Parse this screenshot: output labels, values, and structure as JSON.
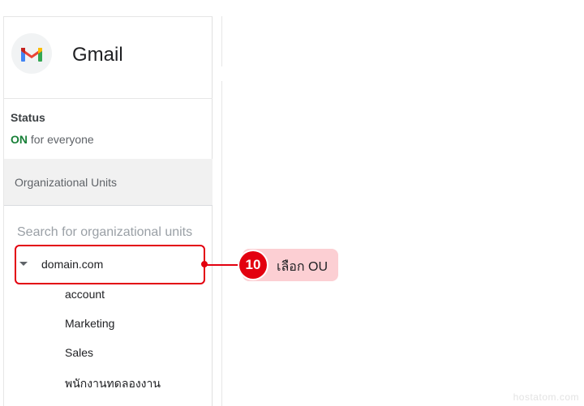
{
  "app": {
    "name": "Gmail",
    "logo_icon": "gmail-logo-icon"
  },
  "status": {
    "title": "Status",
    "state": "ON",
    "scope": "for everyone"
  },
  "org_units": {
    "header": "Organizational Units",
    "search_placeholder": "Search for organizational units",
    "root": "domain.com",
    "children": [
      "account",
      "Marketing",
      "Sales",
      "พนักงานทดลองงาน"
    ]
  },
  "callout": {
    "step": "10",
    "text": "เลือก OU",
    "color": "#e3000f",
    "bubble_color": "#fccfd3"
  },
  "watermark": "hostatom.com",
  "colors": {
    "status_on": "#188038",
    "header_bg": "#f1f1f1"
  }
}
